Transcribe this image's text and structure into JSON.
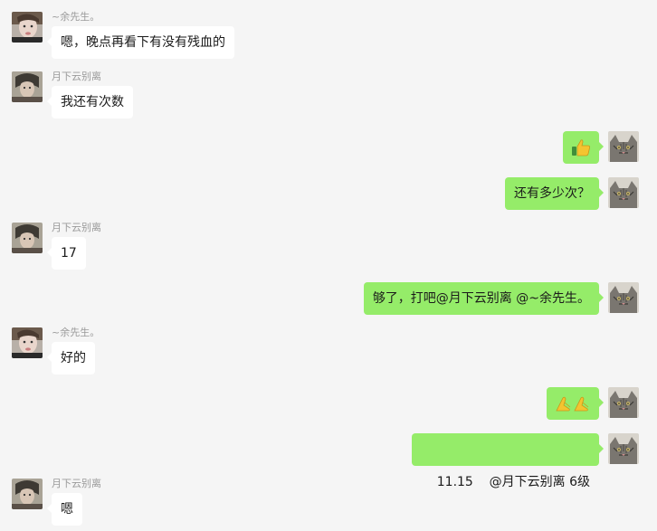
{
  "colors": {
    "background": "#f5f5f5",
    "incoming_bubble": "#ffffff",
    "outgoing_bubble": "#95ec69",
    "sender_name": "#9a9a9a"
  },
  "messages": [
    {
      "direction": "in",
      "sender": "~余先生。",
      "avatar": "user-yu-avatar",
      "text": "嗯，晚点再看下有没有残血的"
    },
    {
      "direction": "in",
      "sender": "月下云别离",
      "avatar": "user-yue-avatar",
      "text": "我还有次数"
    },
    {
      "direction": "out",
      "avatar": "self-cat-avatar",
      "emoji": "thumbs-up-icon"
    },
    {
      "direction": "out",
      "avatar": "self-cat-avatar",
      "text": "还有多少次？"
    },
    {
      "direction": "in",
      "sender": "月下云别离",
      "avatar": "user-yue-avatar",
      "text": "17"
    },
    {
      "direction": "out",
      "avatar": "self-cat-avatar",
      "text": "够了，打吧@月下云别离 @~余先生。"
    },
    {
      "direction": "in",
      "sender": "~余先生。",
      "avatar": "user-yu-avatar",
      "text": "好的"
    },
    {
      "direction": "out",
      "avatar": "self-cat-avatar",
      "emoji": "praying-hands-icon"
    },
    {
      "direction": "out",
      "avatar": "self-cat-avatar",
      "text": "11.15    @月下云别离 6级"
    },
    {
      "direction": "in",
      "sender": "月下云别离",
      "avatar": "user-yue-avatar",
      "text": "嗯"
    }
  ]
}
